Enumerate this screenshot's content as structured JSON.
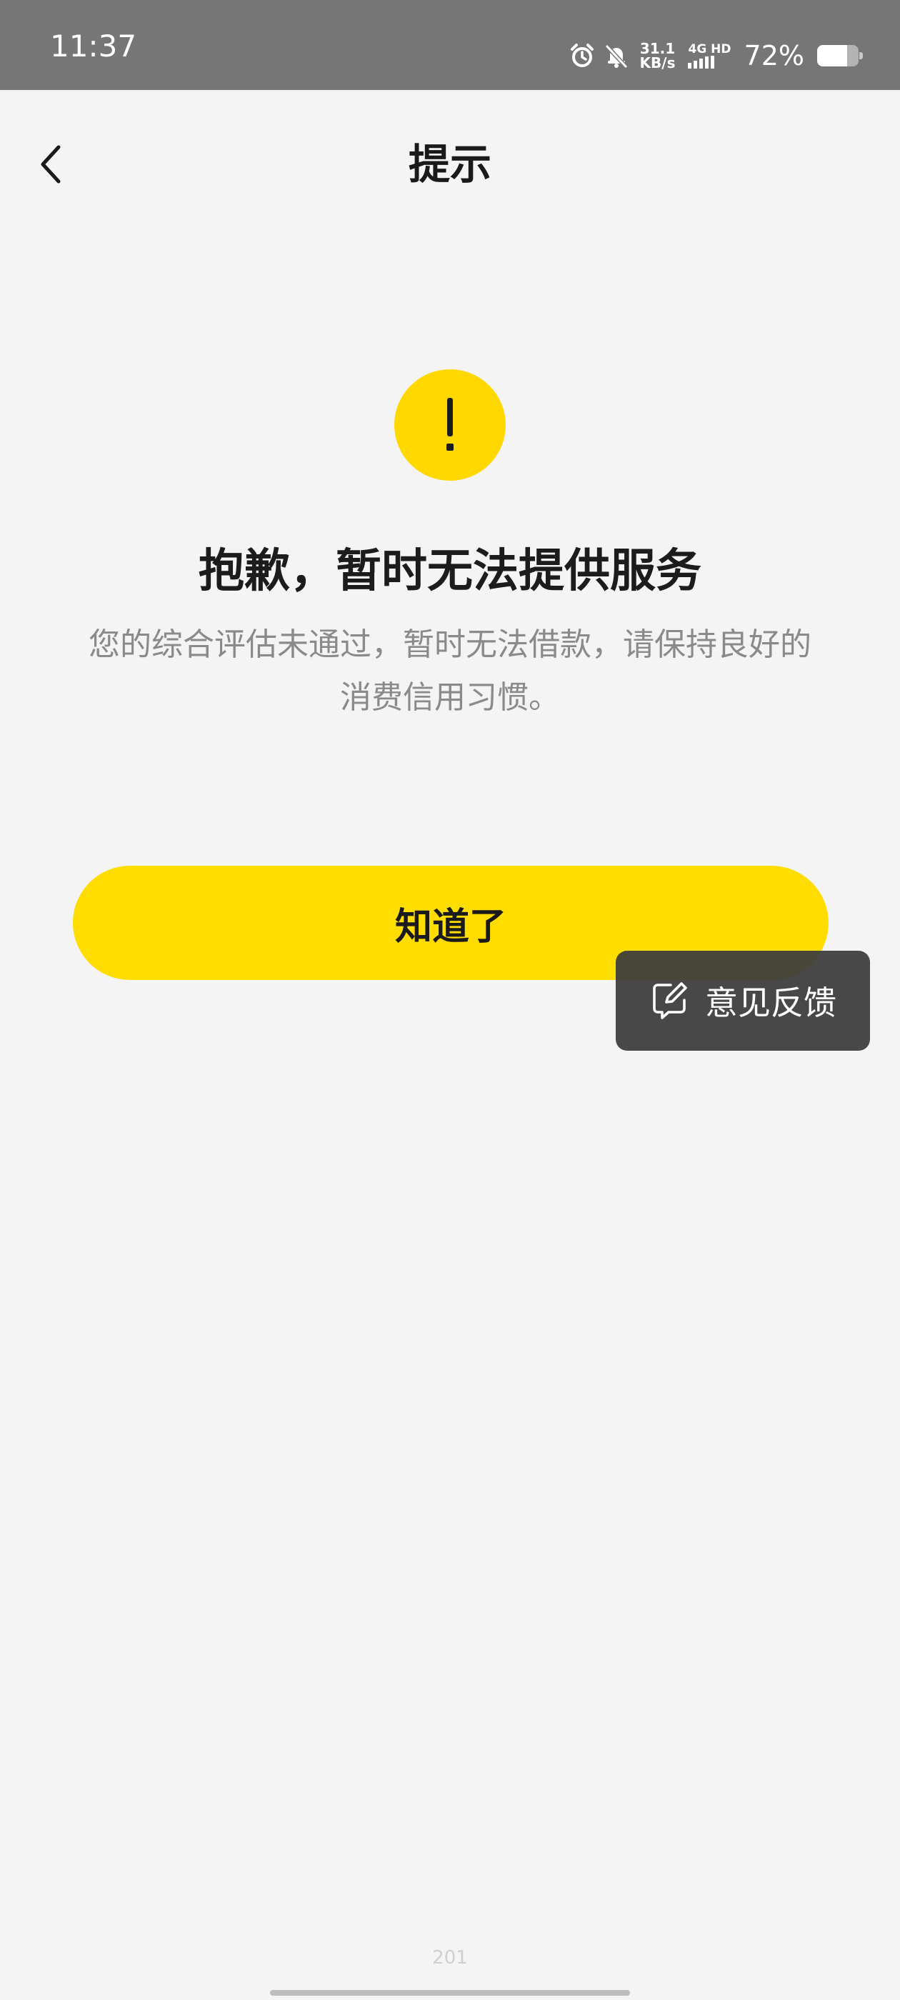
{
  "status_bar": {
    "time": "11:37",
    "net_speed_value": "31.1",
    "net_speed_unit": "KB/s",
    "network_label": "4G HD",
    "battery_percent": "72%",
    "battery_level": 0.72,
    "icons": [
      "alarm-icon",
      "mute-bell-icon",
      "signal-icon",
      "battery-icon"
    ]
  },
  "nav": {
    "back_icon": "chevron-left-icon",
    "title": "提示"
  },
  "message": {
    "icon": "exclamation-icon",
    "icon_color": "#ffd800",
    "headline": "抱歉，暂时无法提供服务",
    "description": "您的综合评估未通过，暂时无法借款，请保持良好的消费信用习惯。"
  },
  "actions": {
    "confirm_label": "知道了",
    "confirm_color": "#ffdd00"
  },
  "feedback": {
    "icon": "feedback-edit-icon",
    "label": "意见反馈"
  },
  "footer": {
    "page_number": "201"
  }
}
